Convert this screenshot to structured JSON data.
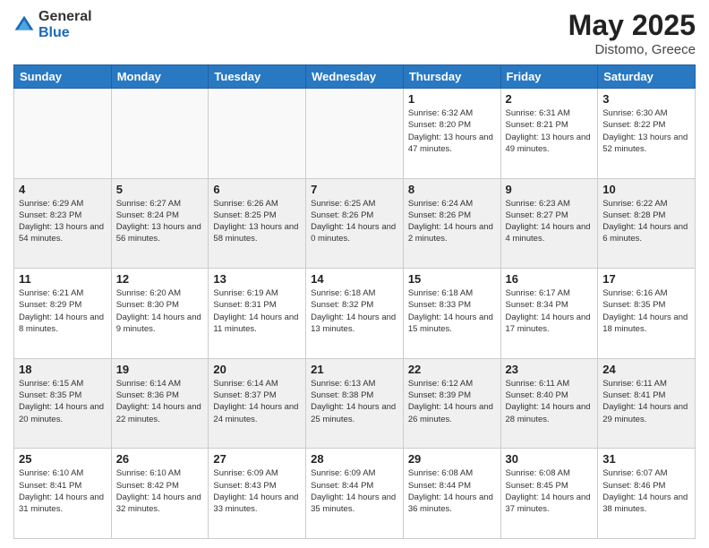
{
  "header": {
    "logo_general": "General",
    "logo_blue": "Blue",
    "month_year": "May 2025",
    "location": "Distomo, Greece"
  },
  "days_of_week": [
    "Sunday",
    "Monday",
    "Tuesday",
    "Wednesday",
    "Thursday",
    "Friday",
    "Saturday"
  ],
  "weeks": [
    [
      {
        "day": "",
        "empty": true
      },
      {
        "day": "",
        "empty": true
      },
      {
        "day": "",
        "empty": true
      },
      {
        "day": "",
        "empty": true
      },
      {
        "day": "1",
        "sunrise": "6:32 AM",
        "sunset": "8:20 PM",
        "daylight": "13 hours and 47 minutes."
      },
      {
        "day": "2",
        "sunrise": "6:31 AM",
        "sunset": "8:21 PM",
        "daylight": "13 hours and 49 minutes."
      },
      {
        "day": "3",
        "sunrise": "6:30 AM",
        "sunset": "8:22 PM",
        "daylight": "13 hours and 52 minutes."
      }
    ],
    [
      {
        "day": "4",
        "sunrise": "6:29 AM",
        "sunset": "8:23 PM",
        "daylight": "13 hours and 54 minutes."
      },
      {
        "day": "5",
        "sunrise": "6:27 AM",
        "sunset": "8:24 PM",
        "daylight": "13 hours and 56 minutes."
      },
      {
        "day": "6",
        "sunrise": "6:26 AM",
        "sunset": "8:25 PM",
        "daylight": "13 hours and 58 minutes."
      },
      {
        "day": "7",
        "sunrise": "6:25 AM",
        "sunset": "8:26 PM",
        "daylight": "14 hours and 0 minutes."
      },
      {
        "day": "8",
        "sunrise": "6:24 AM",
        "sunset": "8:26 PM",
        "daylight": "14 hours and 2 minutes."
      },
      {
        "day": "9",
        "sunrise": "6:23 AM",
        "sunset": "8:27 PM",
        "daylight": "14 hours and 4 minutes."
      },
      {
        "day": "10",
        "sunrise": "6:22 AM",
        "sunset": "8:28 PM",
        "daylight": "14 hours and 6 minutes."
      }
    ],
    [
      {
        "day": "11",
        "sunrise": "6:21 AM",
        "sunset": "8:29 PM",
        "daylight": "14 hours and 8 minutes."
      },
      {
        "day": "12",
        "sunrise": "6:20 AM",
        "sunset": "8:30 PM",
        "daylight": "14 hours and 9 minutes."
      },
      {
        "day": "13",
        "sunrise": "6:19 AM",
        "sunset": "8:31 PM",
        "daylight": "14 hours and 11 minutes."
      },
      {
        "day": "14",
        "sunrise": "6:18 AM",
        "sunset": "8:32 PM",
        "daylight": "14 hours and 13 minutes."
      },
      {
        "day": "15",
        "sunrise": "6:18 AM",
        "sunset": "8:33 PM",
        "daylight": "14 hours and 15 minutes."
      },
      {
        "day": "16",
        "sunrise": "6:17 AM",
        "sunset": "8:34 PM",
        "daylight": "14 hours and 17 minutes."
      },
      {
        "day": "17",
        "sunrise": "6:16 AM",
        "sunset": "8:35 PM",
        "daylight": "14 hours and 18 minutes."
      }
    ],
    [
      {
        "day": "18",
        "sunrise": "6:15 AM",
        "sunset": "8:35 PM",
        "daylight": "14 hours and 20 minutes."
      },
      {
        "day": "19",
        "sunrise": "6:14 AM",
        "sunset": "8:36 PM",
        "daylight": "14 hours and 22 minutes."
      },
      {
        "day": "20",
        "sunrise": "6:14 AM",
        "sunset": "8:37 PM",
        "daylight": "14 hours and 24 minutes."
      },
      {
        "day": "21",
        "sunrise": "6:13 AM",
        "sunset": "8:38 PM",
        "daylight": "14 hours and 25 minutes."
      },
      {
        "day": "22",
        "sunrise": "6:12 AM",
        "sunset": "8:39 PM",
        "daylight": "14 hours and 26 minutes."
      },
      {
        "day": "23",
        "sunrise": "6:11 AM",
        "sunset": "8:40 PM",
        "daylight": "14 hours and 28 minutes."
      },
      {
        "day": "24",
        "sunrise": "6:11 AM",
        "sunset": "8:41 PM",
        "daylight": "14 hours and 29 minutes."
      }
    ],
    [
      {
        "day": "25",
        "sunrise": "6:10 AM",
        "sunset": "8:41 PM",
        "daylight": "14 hours and 31 minutes."
      },
      {
        "day": "26",
        "sunrise": "6:10 AM",
        "sunset": "8:42 PM",
        "daylight": "14 hours and 32 minutes."
      },
      {
        "day": "27",
        "sunrise": "6:09 AM",
        "sunset": "8:43 PM",
        "daylight": "14 hours and 33 minutes."
      },
      {
        "day": "28",
        "sunrise": "6:09 AM",
        "sunset": "8:44 PM",
        "daylight": "14 hours and 35 minutes."
      },
      {
        "day": "29",
        "sunrise": "6:08 AM",
        "sunset": "8:44 PM",
        "daylight": "14 hours and 36 minutes."
      },
      {
        "day": "30",
        "sunrise": "6:08 AM",
        "sunset": "8:45 PM",
        "daylight": "14 hours and 37 minutes."
      },
      {
        "day": "31",
        "sunrise": "6:07 AM",
        "sunset": "8:46 PM",
        "daylight": "14 hours and 38 minutes."
      }
    ]
  ],
  "labels": {
    "sunrise": "Sunrise:",
    "sunset": "Sunset:",
    "daylight": "Daylight:"
  }
}
